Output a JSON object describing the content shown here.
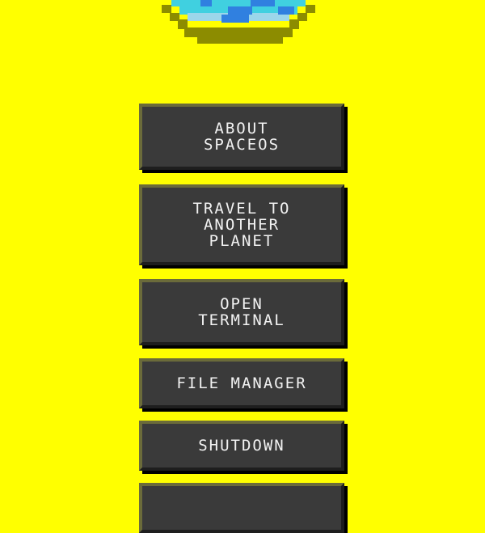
{
  "logo": {
    "icon": "spaceship-icon"
  },
  "menu": {
    "items": [
      {
        "label": "ABOUT\nSPACEOS"
      },
      {
        "label": "TRAVEL TO\nANOTHER\nPLANET"
      },
      {
        "label": "OPEN\nTERMINAL"
      },
      {
        "label": "FILE MANAGER"
      },
      {
        "label": "SHUTDOWN"
      },
      {
        "label": ""
      }
    ]
  },
  "colors": {
    "background": "#ffff00",
    "button": "#3a3a3a",
    "button_text": "#f2f2f2",
    "logo_cyan": "#40d0e0",
    "logo_blue": "#3080e0",
    "logo_olive": "#8c8c00"
  }
}
